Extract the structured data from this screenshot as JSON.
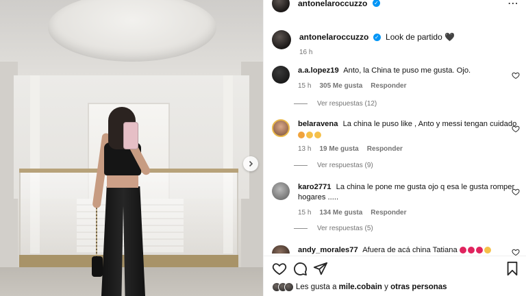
{
  "post": {
    "author": "antonelaroccuzzo",
    "caption": "Look de partido",
    "caption_emoji": "🖤",
    "time": "16 h"
  },
  "comments": [
    {
      "author": "a.a.lopez19",
      "text": "Anto, la China te puso me gusta. Ojo.",
      "time": "15 h",
      "likes": "305 Me gusta",
      "reply_label": "Responder",
      "view_replies": "Ver respuestas (12)"
    },
    {
      "author": "belaravena",
      "text": "La china le puso like , Anto y messi tengan cuidado",
      "emojis": [
        "#f5c04a",
        "#f5c04a",
        "#f5c04a"
      ],
      "time": "13 h",
      "likes": "19 Me gusta",
      "reply_label": "Responder",
      "view_replies": "Ver respuestas (9)"
    },
    {
      "author": "karo2771",
      "text": "La china le pone me gusta ojo q esa le gusta romper hogares .....",
      "time": "15 h",
      "likes": "134 Me gusta",
      "reply_label": "Responder",
      "view_replies": "Ver respuestas (5)"
    },
    {
      "author": "andy_morales77",
      "text": "Afuera de acá china Tatiana",
      "emojis": [
        "#e0245e",
        "#e0245e",
        "#e0245e",
        "#f5c04a"
      ]
    }
  ],
  "likes_summary": {
    "prefix": "Les gusta a",
    "user": "mile.cobain",
    "joiner": "y",
    "rest": "otras personas"
  },
  "icons": [
    "verified-icon",
    "close-icon",
    "heart-icon",
    "comment-icon",
    "share-icon",
    "bookmark-icon",
    "chevron-right-icon"
  ],
  "colors": {
    "verified": "#0095f6",
    "meta": "#737373"
  }
}
